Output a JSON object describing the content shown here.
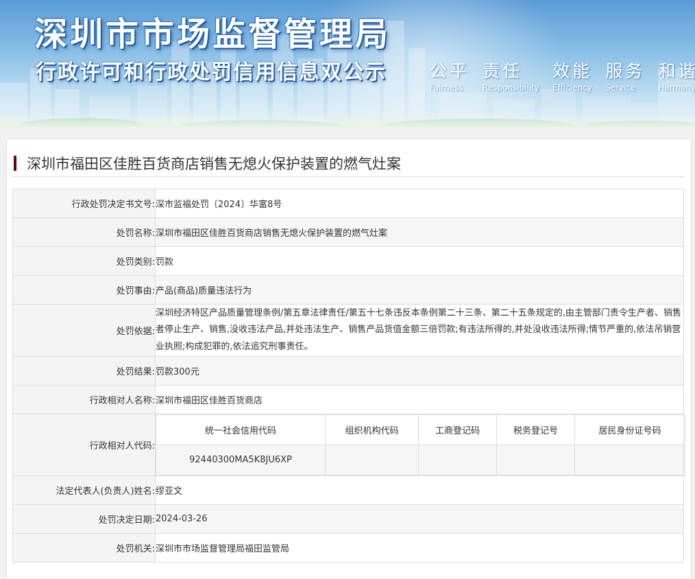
{
  "banner": {
    "title": "深圳市市场监督管理局",
    "subtitle": "行政许可和行政处罚信用信息双公示",
    "slogans": [
      {
        "cn": "公平",
        "en": "Fairness"
      },
      {
        "cn": "责任",
        "en": "Responsibility"
      },
      {
        "cn": "效能",
        "en": "Efficiency"
      },
      {
        "cn": "服务",
        "en": "Service"
      },
      {
        "cn": "和谐",
        "en": "Harmony"
      }
    ]
  },
  "case": {
    "title": "深圳市福田区佳胜百货商店销售无熄火保护装置的燃气灶案",
    "accent_color": "#5b0a0a"
  },
  "fields": {
    "doc_no": {
      "label": "行政处罚决定书文号:",
      "value": "深市监福处罚〔2024〕华富8号"
    },
    "name": {
      "label": "处罚名称:",
      "value": "深圳市福田区佳胜百货商店销售无熄火保护装置的燃气灶案"
    },
    "category": {
      "label": "处罚类别:",
      "value": "罚款"
    },
    "reason": {
      "label": "处罚事由:",
      "value": "产品(商品)质量违法行为"
    },
    "basis": {
      "label": "处罚依据:",
      "value": "深圳经济特区产品质量管理条例/第五章法律责任/第五十七条违反本条例第二十三条、第二十五条规定的,由主管部门责令生产者、销售者停止生产、销售,没收违法产品,并处违法生产、销售产品货值金额三倍罚款;有违法所得的,并处没收违法所得;情节严重的,依法吊销营业执照;构成犯罪的,依法追究刑事责任。"
    },
    "result": {
      "label": "处罚结果:",
      "value": "罚款300元"
    },
    "party_name": {
      "label": "行政相对人名称:",
      "value": "深圳市福田区佳胜百货商店"
    },
    "party_code": {
      "label": "行政相对人代码:",
      "headers": [
        "统一社会信用代码",
        "组织机构代码",
        "工商登记码",
        "税务登记号",
        "居民身份证号码"
      ],
      "values": [
        "92440300MA5K8JU6XP",
        "",
        "",
        "",
        ""
      ]
    },
    "legal_rep": {
      "label": "法定代表人(负责人)姓名:",
      "value": "缪亚文"
    },
    "date": {
      "label": "处罚决定日期:",
      "value": "2024-03-26"
    },
    "authority": {
      "label": "处罚机关:",
      "value": "深圳市市场监督管理局福田监管局"
    }
  }
}
